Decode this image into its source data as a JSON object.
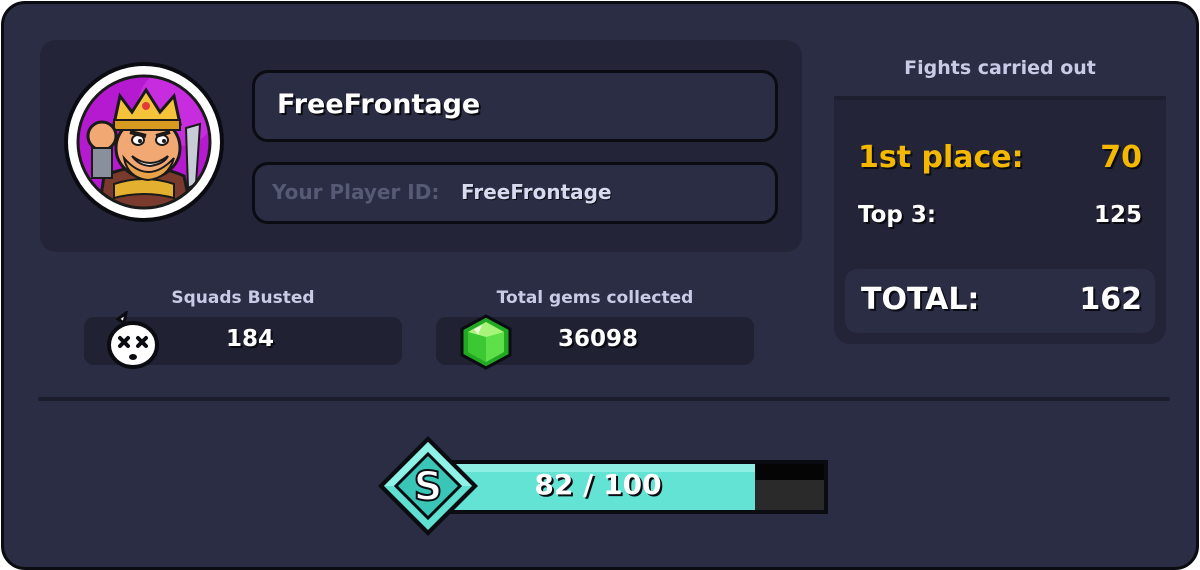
{
  "profile": {
    "player_name": "FreeFrontage",
    "id_label": "Your Player ID:",
    "id_value": "FreeFrontage"
  },
  "stats": {
    "squads_busted": {
      "label": "Squads Busted",
      "value": "184",
      "icon": "skull-face-icon"
    },
    "gems": {
      "label": "Total gems collected",
      "value": "36098",
      "icon": "green-gem-icon"
    }
  },
  "fights": {
    "title": "Fights carried out",
    "first_label": "1st place:",
    "first_value": "70",
    "top3_label": "Top 3:",
    "top3_value": "125",
    "total_label": "TOTAL:",
    "total_value": "162"
  },
  "rank": {
    "letter": "S",
    "progress_text": "82 / 100",
    "progress_fraction": 0.82
  },
  "colors": {
    "accent_gold": "#f5b800",
    "progress_teal": "#62e3d3",
    "panel_dark": "#232438",
    "background": "#2b2d44"
  }
}
